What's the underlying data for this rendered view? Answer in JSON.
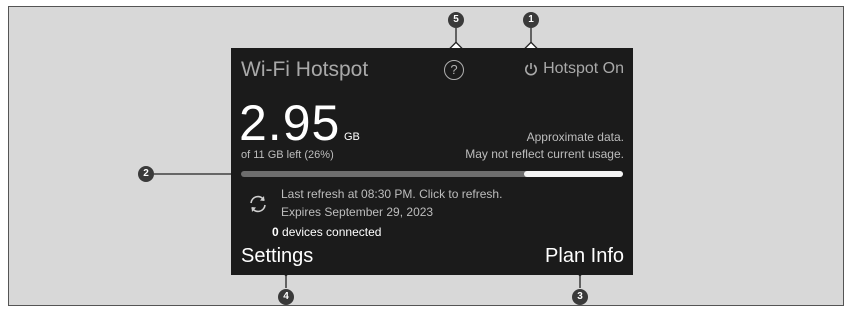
{
  "screen": {
    "title": "Wi-Fi Hotspot",
    "help_icon": "question-circle-icon",
    "help_label": "?",
    "hotspot_status": "Hotspot On",
    "hotspot_icon": "power-icon"
  },
  "usage": {
    "amount": "2.95",
    "unit": "GB",
    "subtext": "of 11 GB left (26%)",
    "fraction_left": 0.26,
    "note_line1": "Approximate data.",
    "note_line2": "May not reflect current usage."
  },
  "refresh": {
    "icon": "refresh-icon",
    "line1": "Last refresh at 08:30 PM. Click to refresh.",
    "line2": "Expires September 29, 2023"
  },
  "devices": {
    "count": "0",
    "label": "devices connected"
  },
  "buttons": {
    "settings": "Settings",
    "plan_info": "Plan Info"
  },
  "callouts": {
    "c1": "1",
    "c2": "2",
    "c3": "3",
    "c4": "4",
    "c5": "5"
  },
  "colors": {
    "screen_bg": "#1b1b1b",
    "frame_bg": "#d8d8d8",
    "bar_fill": "#f4f4f4",
    "bar_track": "#6e6e6e"
  }
}
